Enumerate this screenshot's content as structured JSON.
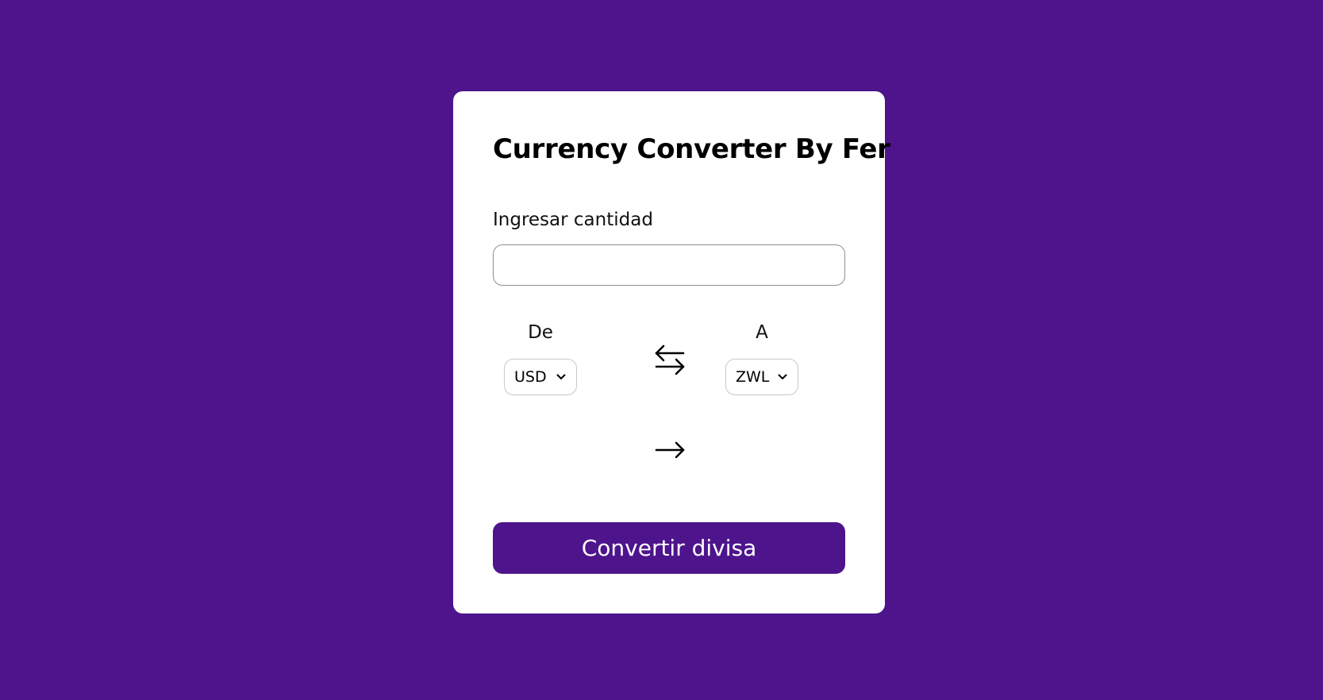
{
  "page": {
    "background_color": "#4d148c",
    "card_color": "#ffffff"
  },
  "converter": {
    "title": "Currency Converter By Fer",
    "amount_label": "Ingresar cantidad",
    "amount_value": "",
    "from_label": "De",
    "from_currency": "USD",
    "to_label": "A",
    "to_currency": "ZWL",
    "swap_icon": "swap-arrows-icon",
    "result_icon": "arrow-right-icon",
    "result_text": "",
    "convert_button_label": "Convertir divisa",
    "button_color": "#4d148c"
  }
}
